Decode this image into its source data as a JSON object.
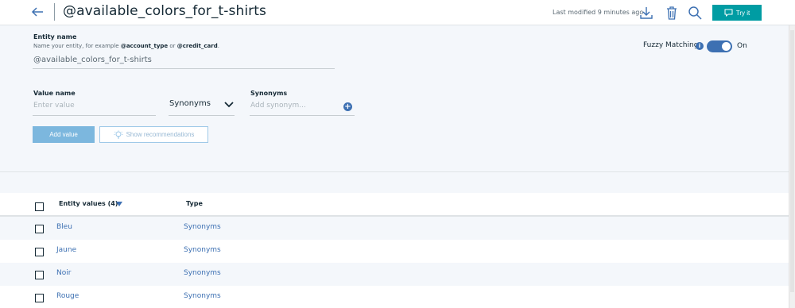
{
  "header": {
    "title": "@available_colors_for_t-shirts",
    "last_modified": "Last modified 9 minutes ago",
    "try_it_label": "Try it"
  },
  "entity_name": {
    "label": "Entity name",
    "help_prefix": "Name your entity, for example ",
    "help_example1": "@account_type",
    "help_or": " or ",
    "help_example2": "@credit_card",
    "help_suffix": ".",
    "value": "@available_colors_for_t-shirts"
  },
  "fuzzy": {
    "label": "Fuzzy Matching",
    "info": "i",
    "state": "On",
    "enabled": true
  },
  "value_form": {
    "value_name_label": "Value name",
    "value_placeholder": "Enter value",
    "type_selected": "Synonyms",
    "synonyms_label": "Synonyms",
    "synonym_placeholder": "Add synonym...",
    "add_value_label": "Add value",
    "recommend_label": "Show recommendations"
  },
  "table": {
    "col_values": "Entity values (4)",
    "col_type": "Type",
    "rows": [
      {
        "value": "Bleu",
        "type": "Synonyms"
      },
      {
        "value": "Jaune",
        "type": "Synonyms"
      },
      {
        "value": "Noir",
        "type": "Synonyms"
      },
      {
        "value": "Rouge",
        "type": "Synonyms"
      }
    ]
  },
  "icons": {
    "back": "arrow-left-icon",
    "download": "download-icon",
    "delete": "trash-icon",
    "search": "search-icon",
    "chat": "chat-bubble-icon",
    "info": "info-icon",
    "chevron": "chevron-down-icon",
    "add": "add-circle-icon",
    "recommend": "lightbulb-icon",
    "sort": "sort-down-icon"
  },
  "colors": {
    "accent": "#3d70b2",
    "try_it": "#009ca3",
    "add_value_bg": "#7cb7de"
  }
}
